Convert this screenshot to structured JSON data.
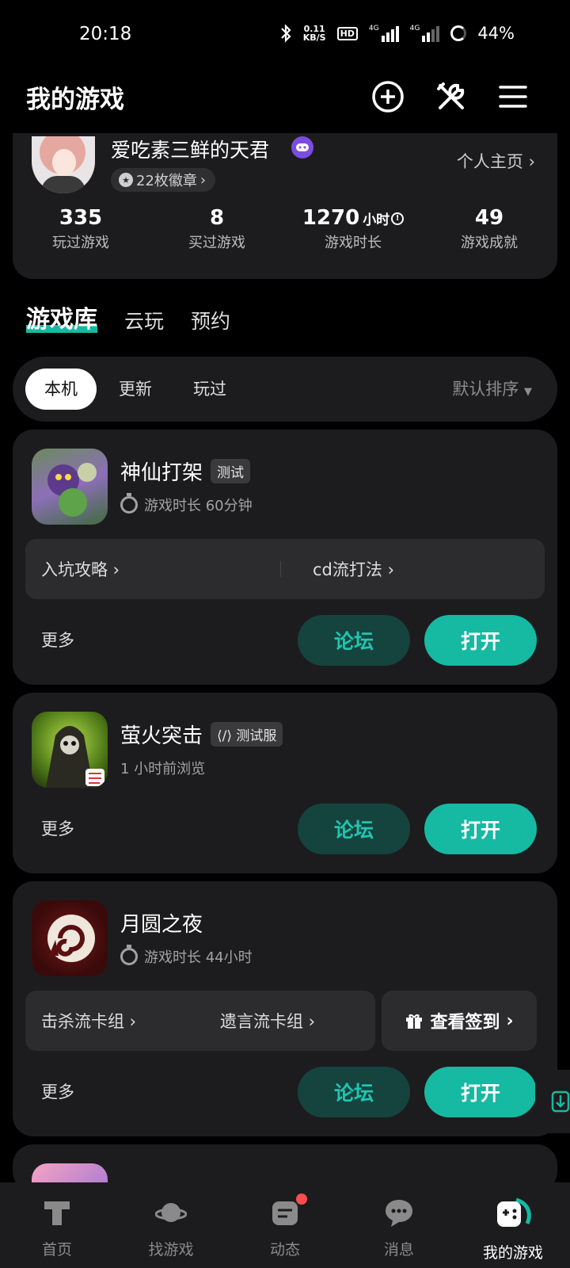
{
  "status_bar": {
    "time": "20:18",
    "net_speed_value": "0.11",
    "net_speed_unit": "KB/S",
    "hd": "HD",
    "sim1": "4G",
    "sim2": "4G",
    "battery": "44%"
  },
  "header": {
    "title": "我的游戏"
  },
  "profile": {
    "username": "爱吃素三鲜的天君",
    "badges": "22枚徽章",
    "homepage_link": "个人主页",
    "stats": [
      {
        "value": "335",
        "unit": "",
        "label": "玩过游戏"
      },
      {
        "value": "8",
        "unit": "",
        "label": "买过游戏"
      },
      {
        "value": "1270",
        "unit": "小时",
        "label": "游戏时长"
      },
      {
        "value": "49",
        "unit": "",
        "label": "游戏成就"
      }
    ]
  },
  "library_tabs": [
    "游戏库",
    "云玩",
    "预约"
  ],
  "filter": {
    "chips": [
      "本机",
      "更新",
      "玩过"
    ],
    "sort": "默认排序"
  },
  "games": [
    {
      "name": "神仙打架",
      "tag": "测试",
      "sub": "游戏时长 60分钟",
      "links": [
        "入坑攻略",
        "cd流打法"
      ],
      "more": "更多",
      "forum": "论坛",
      "open": "打开"
    },
    {
      "name": "萤火突击",
      "tag": "测试服",
      "sub": "1 小时前浏览",
      "more": "更多",
      "forum": "论坛",
      "open": "打开"
    },
    {
      "name": "月圆之夜",
      "sub": "游戏时长 44小时",
      "links": [
        "击杀流卡组",
        "遗言流卡组"
      ],
      "signin": "查看签到",
      "more": "更多",
      "forum": "论坛",
      "open": "打开"
    }
  ],
  "bottom_nav": [
    "首页",
    "找游戏",
    "动态",
    "消息",
    "我的游戏"
  ],
  "colors": {
    "accent": "#16b9a2",
    "card_bg": "#1c1c1e",
    "forum_bg": "#15433e"
  }
}
